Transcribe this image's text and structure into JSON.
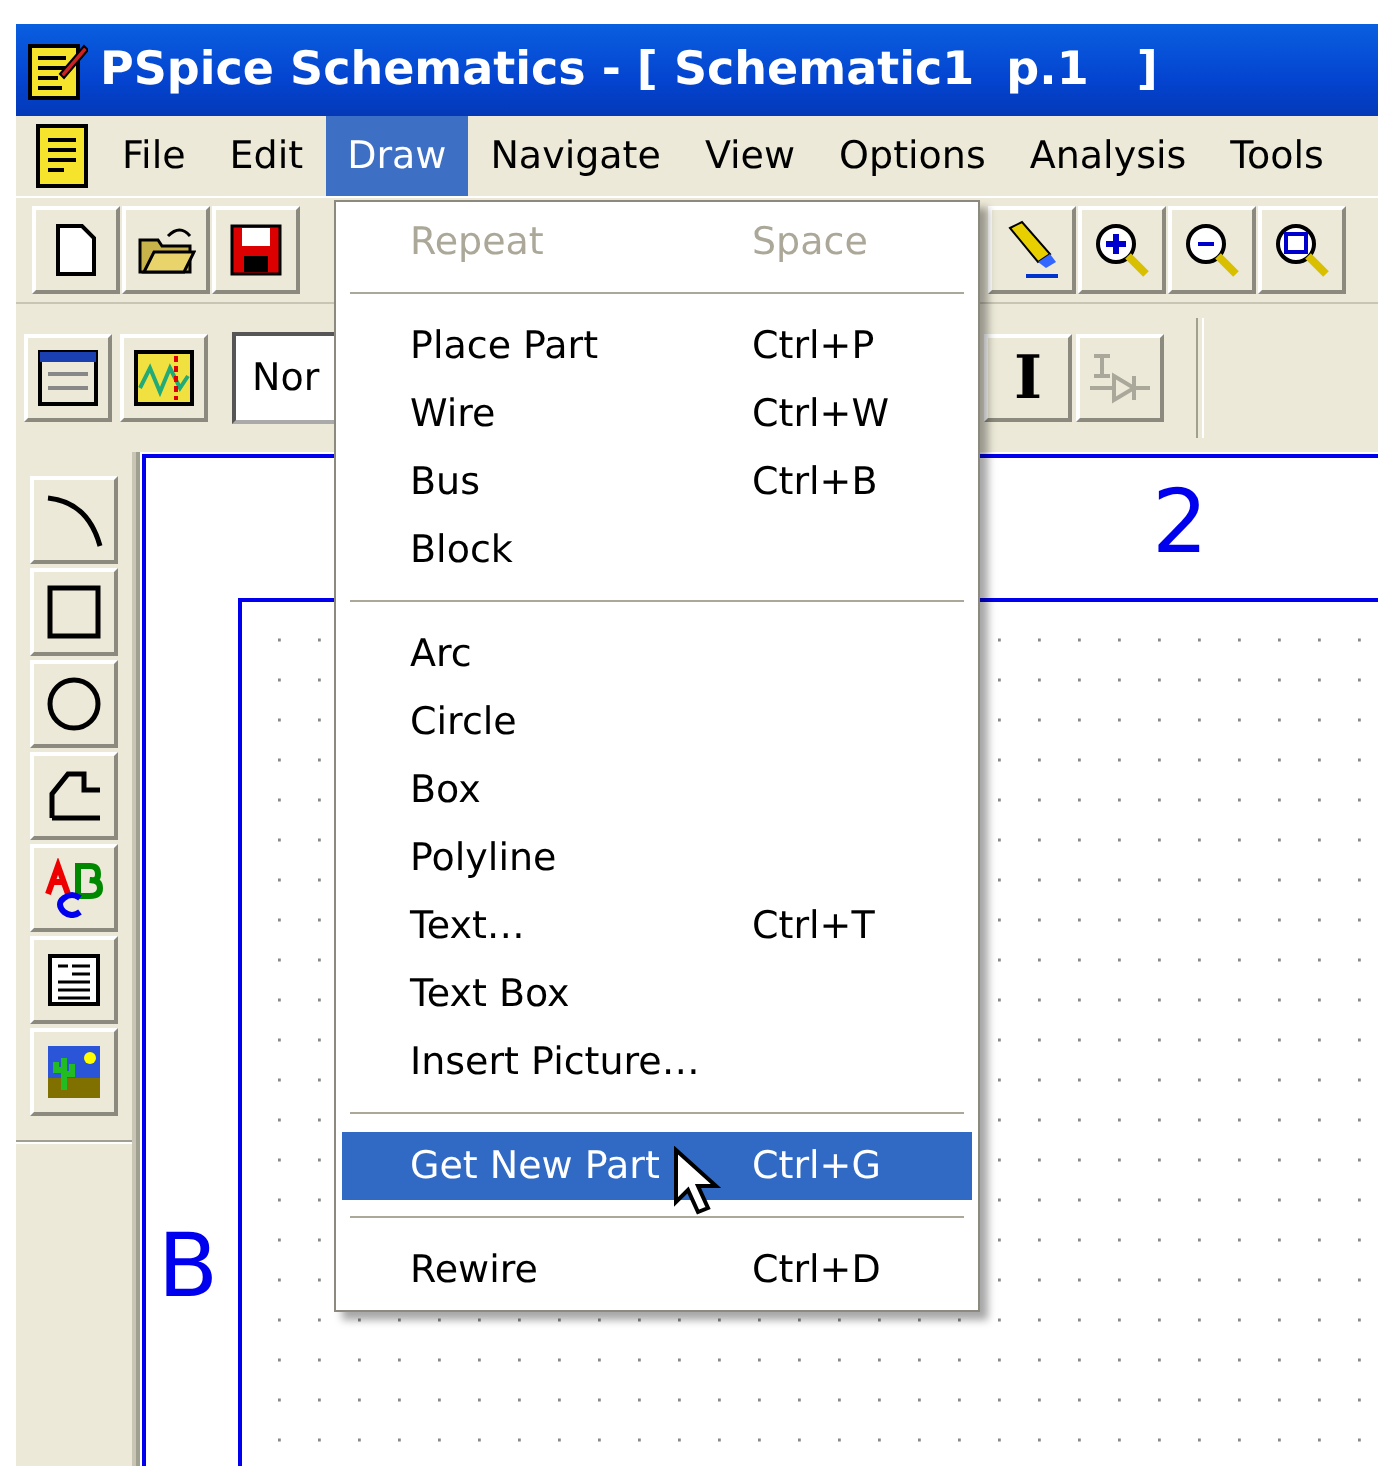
{
  "window": {
    "title": "PSpice Schematics - [ Schematic1  p.1   ]"
  },
  "menu_bar": [
    {
      "label": "File",
      "selected": false
    },
    {
      "label": "Edit",
      "selected": false
    },
    {
      "label": "Draw",
      "selected": true
    },
    {
      "label": "Navigate",
      "selected": false
    },
    {
      "label": "View",
      "selected": false
    },
    {
      "label": "Options",
      "selected": false
    },
    {
      "label": "Analysis",
      "selected": false
    },
    {
      "label": "Tools",
      "selected": false
    }
  ],
  "style_combo": {
    "value": "Nor"
  },
  "format_buttons": [
    {
      "kind": "text",
      "label": "I",
      "disabled": false
    },
    {
      "kind": "icon",
      "disabled": true
    }
  ],
  "canvas": {
    "column_label": "2",
    "row_label": "B"
  },
  "draw_menu": [
    {
      "kind": "item",
      "label": "Repeat",
      "shortcut": "Space",
      "disabled": true,
      "selected": false
    },
    {
      "kind": "separator"
    },
    {
      "kind": "item",
      "label": "Place Part",
      "shortcut": "Ctrl+P",
      "disabled": false,
      "selected": false
    },
    {
      "kind": "item",
      "label": "Wire",
      "shortcut": "Ctrl+W",
      "disabled": false,
      "selected": false
    },
    {
      "kind": "item",
      "label": "Bus",
      "shortcut": "Ctrl+B",
      "disabled": false,
      "selected": false
    },
    {
      "kind": "item",
      "label": "Block",
      "disabled": false,
      "selected": false
    },
    {
      "kind": "separator"
    },
    {
      "kind": "item",
      "label": "Arc",
      "disabled": false,
      "selected": false
    },
    {
      "kind": "item",
      "label": "Circle",
      "disabled": false,
      "selected": false
    },
    {
      "kind": "item",
      "label": "Box",
      "disabled": false,
      "selected": false
    },
    {
      "kind": "item",
      "label": "Polyline",
      "disabled": false,
      "selected": false
    },
    {
      "kind": "item",
      "label": "Text…",
      "shortcut": "Ctrl+T",
      "disabled": false,
      "selected": false
    },
    {
      "kind": "item",
      "label": "Text Box",
      "disabled": false,
      "selected": false
    },
    {
      "kind": "item",
      "label": "Insert Picture…",
      "disabled": false,
      "selected": false
    },
    {
      "kind": "separator"
    },
    {
      "kind": "item",
      "label": "Get New Part",
      "shortcut": "Ctrl+G",
      "disabled": false,
      "selected": true
    },
    {
      "kind": "separator"
    },
    {
      "kind": "item",
      "label": "Rewire",
      "shortcut": "Ctrl+D",
      "disabled": false,
      "selected": false
    }
  ]
}
